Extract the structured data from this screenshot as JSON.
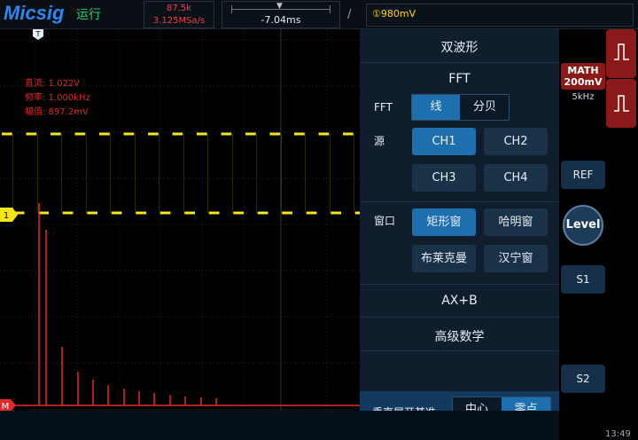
{
  "header": {
    "logo": "Micsig",
    "run_status": "运行",
    "sample_points": "87.5k",
    "sample_rate": "3.125MSa/s",
    "time_offset": "-7.04ms",
    "trigger_level": "980mV",
    "trigger_level_icon": "①"
  },
  "scope": {
    "measurements": {
      "dc": "直流: 1.022V",
      "freq": "频率: 1.000kHz",
      "amplitude": "幅值: 897.2mV"
    },
    "trigger_marker": "T",
    "ch1_marker": "1",
    "math_marker": "M",
    "colors": {
      "ch1": "#f5e616",
      "math": "#e02a2a",
      "grid": "#1c2630",
      "measure": "#e02a2a"
    }
  },
  "panel": {
    "title": "双波形",
    "section": "FFT",
    "fft_label": "FFT",
    "fft_scale": {
      "linear": "线",
      "db": "分贝",
      "selected": "线"
    },
    "source_label": "源",
    "sources": [
      "CH1",
      "CH2",
      "CH3",
      "CH4"
    ],
    "source_selected": "CH1",
    "window_label": "窗口",
    "windows": [
      "矩形窗",
      "哈明窗",
      "布莱克曼",
      "汉宁窗"
    ],
    "window_selected": "矩形窗",
    "axb": "AX+B",
    "advanced": "高级数学",
    "vertical_label": "垂直展开基准",
    "vertical_options": {
      "center": "中心",
      "zero": "零点",
      "selected": "零点"
    }
  },
  "rail": {
    "math_title": "MATH",
    "math_scale": "200mV",
    "math_freq": "5kHz",
    "ref": "REF",
    "level": "Level",
    "s1": "S1",
    "s2": "S2"
  },
  "clock": "13:49"
}
